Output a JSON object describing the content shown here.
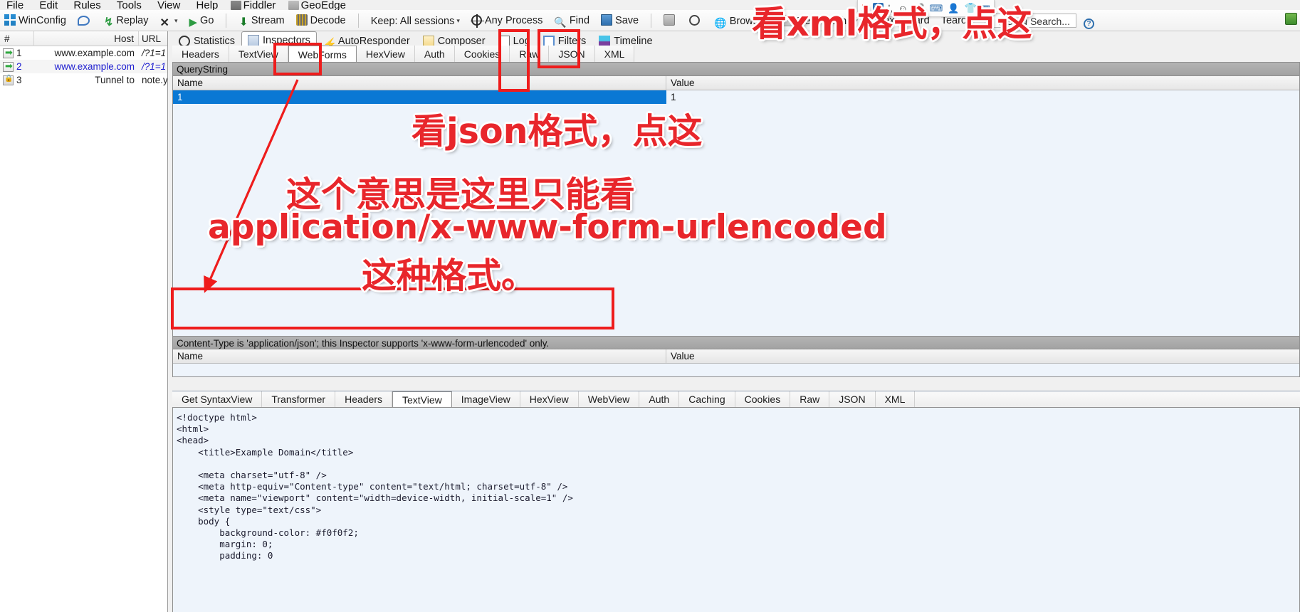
{
  "window": {
    "menu": [
      "File",
      "Edit",
      "Rules",
      "Tools",
      "View",
      "Help"
    ],
    "menu_extra": [
      {
        "label": "Fiddler",
        "icon": "fiddler-icon"
      },
      {
        "label": "GeoEdge",
        "icon": "geoedge-icon"
      }
    ]
  },
  "toolbar": {
    "winconfig": "WinConfig",
    "bubble_icon": "comment-icon",
    "replay": "Replay",
    "clear": "X",
    "go": "Go",
    "stream": "Stream",
    "decode": "Decode",
    "keep": "Keep: All sessions",
    "any_process": "Any Process",
    "find": "Find",
    "save": "Save",
    "camera_icon": "camera-icon",
    "timer_icon": "timer-icon",
    "browse": "Browse",
    "clear_cache": "Clear Cache",
    "textwizard": "TextWizard",
    "tearoff": "Tearoff",
    "msdn_search": "MSDN Search...",
    "help_icon": "help-icon"
  },
  "ime": {
    "items": [
      "s-logo-icon",
      "english-mode-icon",
      "punctuation-icon",
      "emoji-icon",
      "voice-icon",
      "keyboard-icon",
      "user-icon",
      "skin-icon",
      "apps-icon"
    ]
  },
  "sessions": {
    "columns": [
      "#",
      "Host",
      "URL"
    ],
    "rows": [
      {
        "num": "1",
        "host": "www.example.com",
        "url": "/?1=1",
        "icon": "request-arrow-icon",
        "highlight": false
      },
      {
        "num": "2",
        "host": "www.example.com",
        "url": "/?1=1",
        "icon": "request-arrow-icon",
        "highlight": true
      },
      {
        "num": "3",
        "host": "Tunnel to",
        "url": "note.y",
        "icon": "lock-icon",
        "highlight": false
      }
    ]
  },
  "main_tabs": [
    {
      "label": "Statistics",
      "icon": "statistics-icon",
      "active": false
    },
    {
      "label": "Inspectors",
      "icon": "inspectors-icon",
      "active": true
    },
    {
      "label": "AutoResponder",
      "icon": "autoresponder-icon",
      "active": false
    },
    {
      "label": "Composer",
      "icon": "composer-icon",
      "active": false
    },
    {
      "label": "Log",
      "icon": "log-icon",
      "active": false
    },
    {
      "label": "Filters",
      "icon": "filters-icon",
      "active": false
    },
    {
      "label": "Timeline",
      "icon": "timeline-icon",
      "active": false
    }
  ],
  "request_tabs": [
    {
      "label": "Headers",
      "active": false
    },
    {
      "label": "TextView",
      "active": false
    },
    {
      "label": "WebForms",
      "active": true
    },
    {
      "label": "HexView",
      "active": false
    },
    {
      "label": "Auth",
      "active": false
    },
    {
      "label": "Cookies",
      "active": false
    },
    {
      "label": "Raw",
      "active": false
    },
    {
      "label": "JSON",
      "active": false
    },
    {
      "label": "XML",
      "active": false
    }
  ],
  "request_panel": {
    "section_title": "QueryString",
    "columns": {
      "name": "Name",
      "value": "Value"
    },
    "rows": [
      {
        "name": "1",
        "value": "1",
        "selected": true
      }
    ],
    "body_note": "Content-Type is 'application/json'; this Inspector supports 'x-www-form-urlencoded' only.",
    "body_columns": {
      "name": "Name",
      "value": "Value"
    }
  },
  "response_tabs": [
    {
      "label": "Get SyntaxView",
      "active": false
    },
    {
      "label": "Transformer",
      "active": false
    },
    {
      "label": "Headers",
      "active": false
    },
    {
      "label": "TextView",
      "active": true
    },
    {
      "label": "ImageView",
      "active": false
    },
    {
      "label": "HexView",
      "active": false
    },
    {
      "label": "WebView",
      "active": false
    },
    {
      "label": "Auth",
      "active": false
    },
    {
      "label": "Caching",
      "active": false
    },
    {
      "label": "Cookies",
      "active": false
    },
    {
      "label": "Raw",
      "active": false
    },
    {
      "label": "JSON",
      "active": false
    },
    {
      "label": "XML",
      "active": false
    }
  ],
  "response_body": "<!doctype html>\n<html>\n<head>\n    <title>Example Domain</title>\n\n    <meta charset=\"utf-8\" />\n    <meta http-equiv=\"Content-type\" content=\"text/html; charset=utf-8\" />\n    <meta name=\"viewport\" content=\"width=device-width, initial-scale=1\" />\n    <style type=\"text/css\">\n    body {\n        background-color: #f0f0f2;\n        margin: 0;\n        padding: 0",
  "annotations": {
    "xml_hint": "看xml格式，点这",
    "json_hint": "看json格式，点这",
    "explain_line1": "这个意思是这里只能看",
    "explain_line2": "application/x-www-form-urlencoded",
    "explain_line3": "这种格式。"
  },
  "colors": {
    "annotation_red": "#e8262b",
    "box_red": "#ee1c1c",
    "selection_blue": "#0a78d4",
    "link_blue": "#2020d0",
    "panel_bg": "#eef4fb"
  }
}
